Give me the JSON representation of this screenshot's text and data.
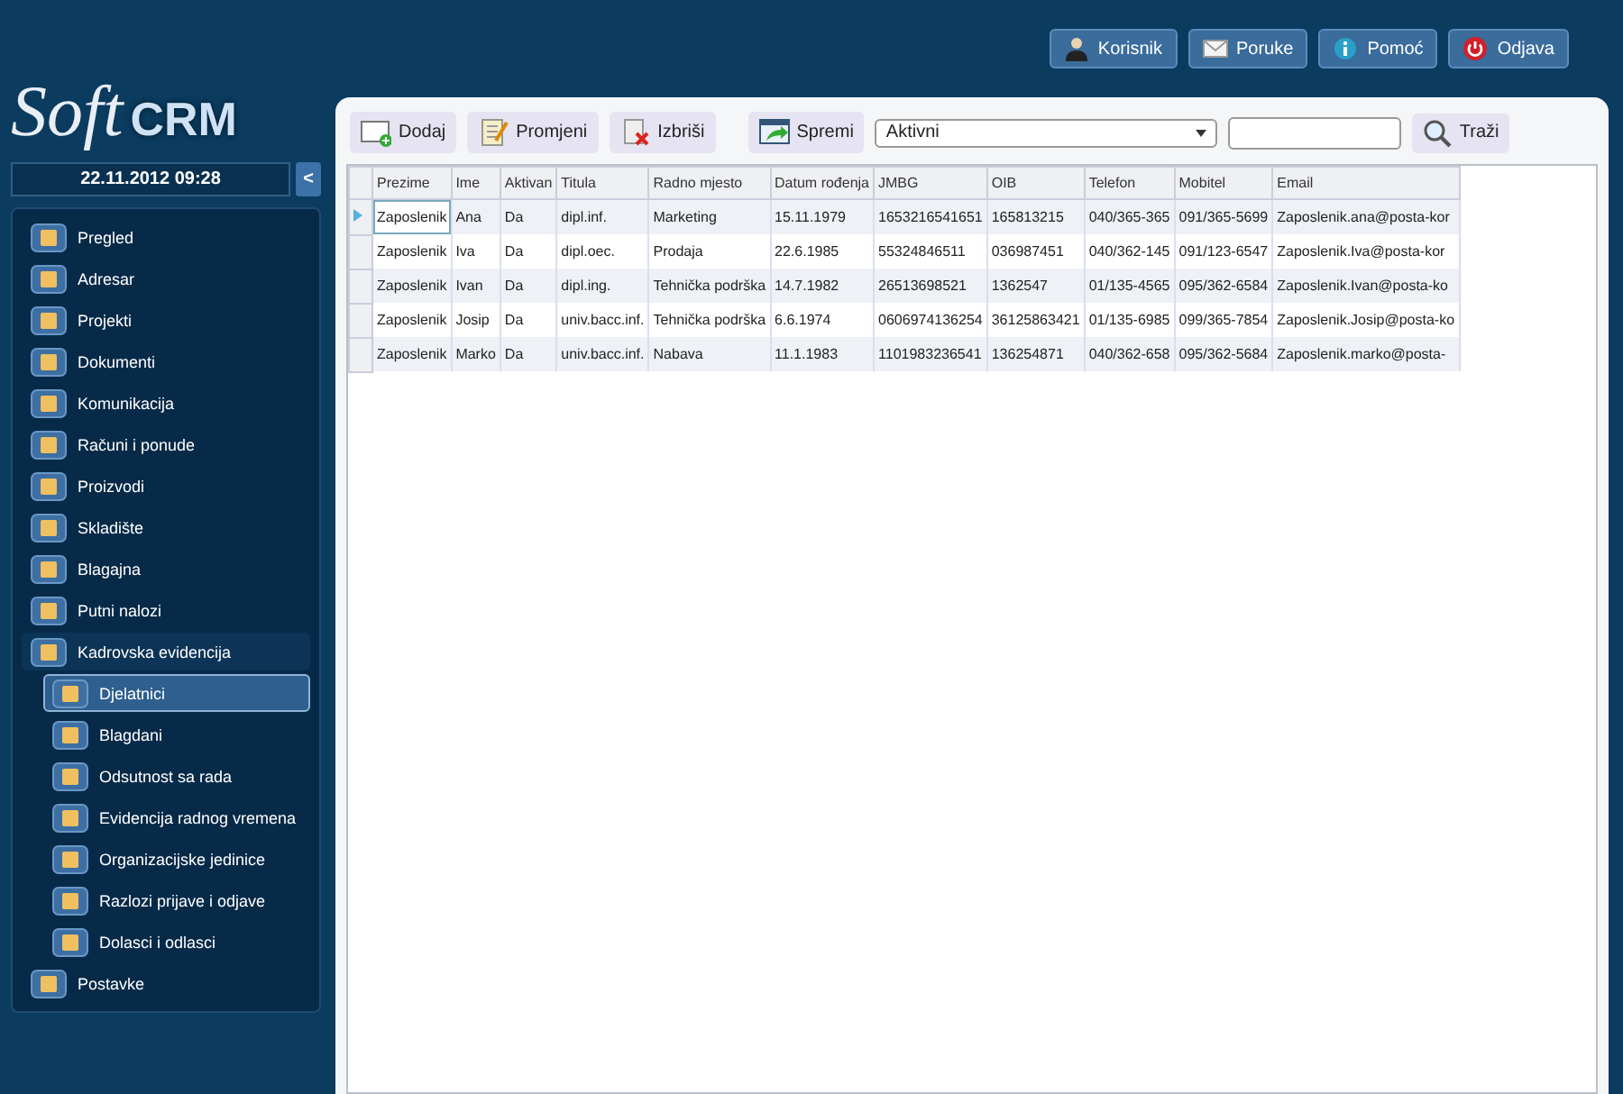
{
  "logo": {
    "script_part": "Soft",
    "bold_part": "CRM"
  },
  "top_buttons": [
    {
      "label": "Korisnik"
    },
    {
      "label": "Poruke"
    },
    {
      "label": "Pomoć"
    },
    {
      "label": "Odjava"
    }
  ],
  "datetime": "22.11.2012 09:28",
  "collapse_button": "<",
  "sidebar": {
    "items": [
      {
        "label": "Pregled",
        "selected": false
      },
      {
        "label": "Adresar",
        "selected": false
      },
      {
        "label": "Projekti",
        "selected": false
      },
      {
        "label": "Dokumenti",
        "selected": false
      },
      {
        "label": "Komunikacija",
        "selected": false
      },
      {
        "label": "Računi i ponude",
        "selected": false
      },
      {
        "label": "Proizvodi",
        "selected": false
      },
      {
        "label": "Skladište",
        "selected": false
      },
      {
        "label": "Blagajna",
        "selected": false
      },
      {
        "label": "Putni nalozi",
        "selected": false
      },
      {
        "label": "Kadrovska evidencija",
        "selected": false,
        "expanded": true,
        "children": [
          {
            "label": "Djelatnici",
            "selected": true
          },
          {
            "label": "Blagdani",
            "selected": false
          },
          {
            "label": "Odsutnost sa rada",
            "selected": false
          },
          {
            "label": "Evidencija radnog vremena",
            "selected": false
          },
          {
            "label": "Organizacijske jedinice",
            "selected": false
          },
          {
            "label": "Razlozi prijave i odjave",
            "selected": false
          },
          {
            "label": "Dolasci i odlasci",
            "selected": false
          }
        ]
      },
      {
        "label": "Postavke",
        "selected": false
      }
    ]
  },
  "toolbar": {
    "buttons": [
      {
        "label": "Dodaj"
      },
      {
        "label": "Promjeni"
      },
      {
        "label": "Izbriši"
      },
      {
        "label": "Spremi"
      }
    ],
    "filter": {
      "value": "Aktivni"
    },
    "search_button": "Traži"
  },
  "table": {
    "columns": [
      "Prezime",
      "Ime",
      "Aktivan",
      "Titula",
      "Radno mjesto",
      "Datum rođenja",
      "JMBG",
      "OIB",
      "Telefon",
      "Mobitel",
      "Email"
    ],
    "rows": [
      {
        "selected": true,
        "cells": [
          "Zaposlenik",
          "Ana",
          "Da",
          "dipl.inf.",
          "Marketing",
          "15.11.1979",
          "1653216541651",
          "165813215",
          "040/365-365",
          "091/365-5699",
          "Zaposlenik.ana@posta-kor"
        ]
      },
      {
        "selected": false,
        "cells": [
          "Zaposlenik",
          "Iva",
          "Da",
          "dipl.oec.",
          "Prodaja",
          "22.6.1985",
          "55324846511",
          "036987451",
          "040/362-145",
          "091/123-6547",
          "Zaposlenik.Iva@posta-kor"
        ]
      },
      {
        "selected": false,
        "cells": [
          "Zaposlenik",
          "Ivan",
          "Da",
          "dipl.ing.",
          "Tehnička podrška",
          "14.7.1982",
          "26513698521",
          "1362547",
          "01/135-4565",
          "095/362-6584",
          "Zaposlenik.Ivan@posta-ko"
        ]
      },
      {
        "selected": false,
        "cells": [
          "Zaposlenik",
          "Josip",
          "Da",
          "univ.bacc.inf.",
          "Tehnička podrška",
          "6.6.1974",
          "0606974136254",
          "36125863421",
          "01/135-6985",
          "099/365-7854",
          "Zaposlenik.Josip@posta-ko"
        ]
      },
      {
        "selected": false,
        "cells": [
          "Zaposlenik",
          "Marko",
          "Da",
          "univ.bacc.inf.",
          "Nabava",
          "11.1.1983",
          "1101983236541",
          "136254871",
          "040/362-658",
          "095/362-5684",
          "Zaposlenik.marko@posta-"
        ]
      }
    ]
  }
}
